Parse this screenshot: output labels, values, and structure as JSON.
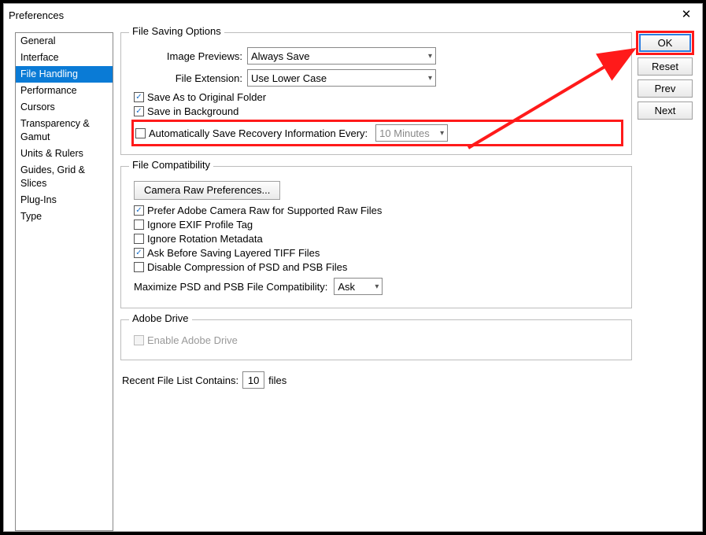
{
  "title": "Preferences",
  "close_glyph": "✕",
  "sidebar": {
    "items": [
      {
        "label": "General"
      },
      {
        "label": "Interface"
      },
      {
        "label": "File Handling",
        "selected": true
      },
      {
        "label": "Performance"
      },
      {
        "label": "Cursors"
      },
      {
        "label": "Transparency & Gamut"
      },
      {
        "label": "Units & Rulers"
      },
      {
        "label": "Guides, Grid & Slices"
      },
      {
        "label": "Plug-Ins"
      },
      {
        "label": "Type"
      }
    ]
  },
  "buttons": {
    "ok": "OK",
    "reset": "Reset",
    "prev": "Prev",
    "next": "Next"
  },
  "saving": {
    "legend": "File Saving Options",
    "previews_label": "Image Previews:",
    "previews_value": "Always Save",
    "ext_label": "File Extension:",
    "ext_value": "Use Lower Case",
    "save_as_orig": "Save As to Original Folder",
    "save_bg": "Save in Background",
    "auto_save": "Automatically Save Recovery Information Every:",
    "auto_save_interval": "10 Minutes"
  },
  "compat": {
    "legend": "File Compatibility",
    "camera_raw_btn": "Camera Raw Preferences...",
    "prefer_acr": "Prefer Adobe Camera Raw for Supported Raw Files",
    "ignore_exif": "Ignore EXIF Profile Tag",
    "ignore_rot": "Ignore Rotation Metadata",
    "ask_tiff": "Ask Before Saving Layered TIFF Files",
    "disable_psd": "Disable Compression of PSD and PSB Files",
    "max_psd_label": "Maximize PSD and PSB File Compatibility:",
    "max_psd_value": "Ask"
  },
  "adobe_drive": {
    "legend": "Adobe Drive",
    "enable": "Enable Adobe Drive"
  },
  "recent": {
    "label_pre": "Recent File List Contains:",
    "value": "10",
    "label_post": "files"
  },
  "check": "✓"
}
